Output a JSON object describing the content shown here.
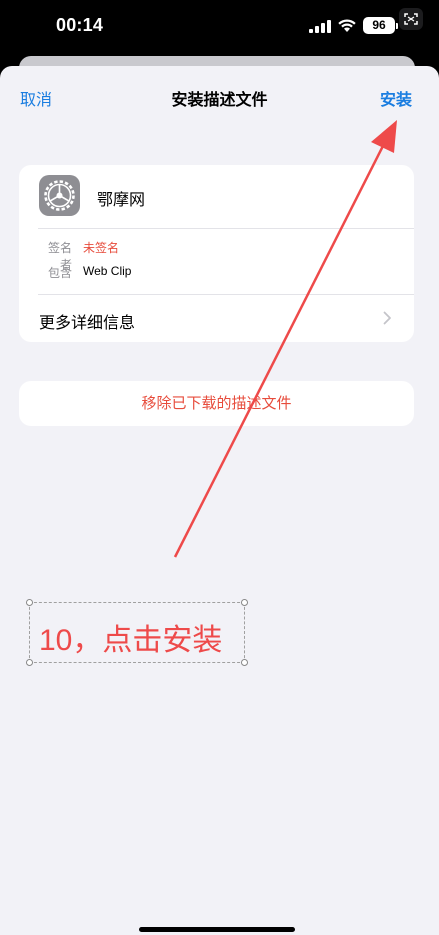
{
  "status_bar": {
    "time": "00:14",
    "battery": "96"
  },
  "nav": {
    "cancel": "取消",
    "title": "安装描述文件",
    "install": "安装"
  },
  "profile": {
    "name": "鄂摩网",
    "icon": "settings-gear-icon",
    "signer_label": "签名者",
    "signer_value": "未签名",
    "contains_label": "包含",
    "contains_value": "Web Clip",
    "more_details": "更多详细信息"
  },
  "remove_button": "移除已下载的描述文件",
  "annotation": {
    "text": "10，点击安装",
    "color": "#ee4a4a"
  },
  "colors": {
    "accent": "#1a7de0",
    "destructive": "#e74c3c",
    "background": "#f2f2f7"
  }
}
